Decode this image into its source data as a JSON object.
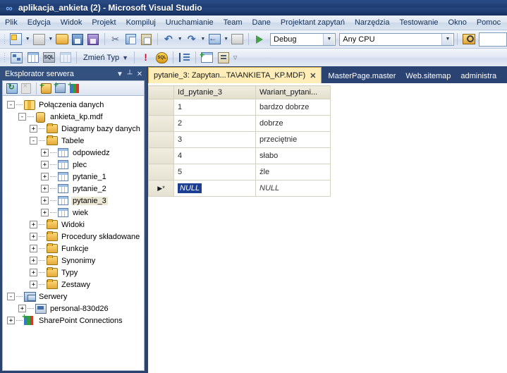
{
  "window": {
    "title": "aplikacja_ankieta (2) - Microsoft Visual Studio",
    "logo_icon": "visual-studio-infinity-icon"
  },
  "menu": {
    "items": [
      {
        "label": "Plik"
      },
      {
        "label": "Edycja"
      },
      {
        "label": "Widok"
      },
      {
        "label": "Projekt"
      },
      {
        "label": "Kompiluj"
      },
      {
        "label": "Uruchamianie"
      },
      {
        "label": "Team"
      },
      {
        "label": "Dane"
      },
      {
        "label": "Projektant zapytań"
      },
      {
        "label": "Narzędzia"
      },
      {
        "label": "Testowanie"
      },
      {
        "label": "Okno"
      },
      {
        "label": "Pomoc"
      }
    ]
  },
  "toolbar_standard": {
    "buttons": [
      {
        "icon": "new-project-icon"
      },
      {
        "icon": "new-web-site-icon"
      },
      {
        "icon": "open-file-icon"
      },
      {
        "icon": "save-icon"
      },
      {
        "icon": "save-all-icon"
      },
      {
        "icon": "cut-icon"
      },
      {
        "icon": "copy-icon"
      },
      {
        "icon": "paste-icon"
      },
      {
        "icon": "undo-icon"
      },
      {
        "icon": "redo-icon"
      },
      {
        "icon": "navigate-backward-icon"
      },
      {
        "icon": "navigate-forward-icon"
      },
      {
        "icon": "start-debugging-icon"
      }
    ],
    "configuration": {
      "value": "Debug",
      "dropdown_icon": "chevron-down-icon"
    },
    "platform": {
      "value": "Any CPU",
      "dropdown_icon": "chevron-down-icon"
    },
    "find_icon": "find-in-files-icon",
    "find_input": {
      "value": "",
      "placeholder": ""
    }
  },
  "toolbar_query": {
    "buttons": [
      {
        "icon": "show-diagram-pane-icon"
      },
      {
        "icon": "show-results-pane-icon"
      },
      {
        "icon": "show-sql-pane-icon"
      },
      {
        "icon": "show-grid-pane-icon"
      }
    ],
    "change_type": {
      "label": "Zmień Typ",
      "dropdown_icon": "chevron-down-icon"
    },
    "buttons2": [
      {
        "icon": "execute-sql-icon"
      },
      {
        "icon": "verify-sql-syntax-icon"
      },
      {
        "icon": "group-by-icon"
      },
      {
        "icon": "add-table-icon"
      },
      {
        "icon": "add-new-derived-table-icon"
      }
    ],
    "overflow_icon": "toolbar-overflow-icon"
  },
  "server_explorer": {
    "title": "Eksplorator serwera",
    "window_buttons": [
      {
        "icon": "chevron-down-icon"
      },
      {
        "icon": "pin-icon"
      },
      {
        "icon": "close-icon"
      }
    ],
    "toolbar": [
      {
        "icon": "refresh-icon"
      },
      {
        "icon": "disconnect-icon"
      },
      {
        "icon": "connect-to-database-icon"
      },
      {
        "icon": "connect-to-server-icon"
      },
      {
        "icon": "add-sharepoint-connection-icon"
      }
    ],
    "tree": [
      {
        "label": "Połączenia danych",
        "indent": 0,
        "expander": "-",
        "icon": "data-connections-icon",
        "selected": false
      },
      {
        "label": "ankieta_kp.mdf",
        "indent": 1,
        "expander": "-",
        "icon": "database-icon",
        "selected": false
      },
      {
        "label": "Diagramy bazy danych",
        "indent": 2,
        "expander": "+",
        "icon": "folder-icon",
        "selected": false
      },
      {
        "label": "Tabele",
        "indent": 2,
        "expander": "-",
        "icon": "folder-icon",
        "selected": false
      },
      {
        "label": "odpowiedz",
        "indent": 3,
        "expander": "+",
        "icon": "table-icon",
        "selected": false
      },
      {
        "label": "plec",
        "indent": 3,
        "expander": "+",
        "icon": "table-icon",
        "selected": false
      },
      {
        "label": "pytanie_1",
        "indent": 3,
        "expander": "+",
        "icon": "table-icon",
        "selected": false
      },
      {
        "label": "pytanie_2",
        "indent": 3,
        "expander": "+",
        "icon": "table-icon",
        "selected": false
      },
      {
        "label": "pytanie_3",
        "indent": 3,
        "expander": "+",
        "icon": "table-icon",
        "selected": true
      },
      {
        "label": "wiek",
        "indent": 3,
        "expander": "+",
        "icon": "table-icon",
        "selected": false
      },
      {
        "label": "Widoki",
        "indent": 2,
        "expander": "+",
        "icon": "folder-icon",
        "selected": false
      },
      {
        "label": "Procedury składowane",
        "indent": 2,
        "expander": "+",
        "icon": "folder-icon",
        "selected": false
      },
      {
        "label": "Funkcje",
        "indent": 2,
        "expander": "+",
        "icon": "folder-icon",
        "selected": false
      },
      {
        "label": "Synonimy",
        "indent": 2,
        "expander": "+",
        "icon": "folder-icon",
        "selected": false
      },
      {
        "label": "Typy",
        "indent": 2,
        "expander": "+",
        "icon": "folder-icon",
        "selected": false
      },
      {
        "label": "Zestawy",
        "indent": 2,
        "expander": "+",
        "icon": "folder-icon",
        "selected": false
      },
      {
        "label": "Serwery",
        "indent": 0,
        "expander": "-",
        "icon": "servers-icon",
        "selected": false
      },
      {
        "label": "personal-830d26",
        "indent": 1,
        "expander": "+",
        "icon": "computer-icon",
        "selected": false
      },
      {
        "label": "SharePoint Connections",
        "indent": 0,
        "expander": "+",
        "icon": "sharepoint-icon",
        "selected": false
      }
    ]
  },
  "document_tabs": [
    {
      "label": "pytanie_3: Zapytan...TA\\ANKIETA_KP.MDF)",
      "active": true,
      "close_icon": "close-icon"
    },
    {
      "label": "MasterPage.master",
      "active": false
    },
    {
      "label": "Web.sitemap",
      "active": false
    },
    {
      "label": "administra",
      "active": false
    }
  ],
  "results_grid": {
    "columns": [
      {
        "label": "Id_pytanie_3",
        "width": 110
      },
      {
        "label": "Wariant_pytani...",
        "width": 100
      }
    ],
    "rows": [
      {
        "marker": "",
        "cells": [
          "1",
          "bardzo dobrze"
        ],
        "is_new_row": false
      },
      {
        "marker": "",
        "cells": [
          "2",
          "dobrze"
        ],
        "is_new_row": false
      },
      {
        "marker": "",
        "cells": [
          "3",
          "przeciętnie"
        ],
        "is_new_row": false
      },
      {
        "marker": "",
        "cells": [
          "4",
          "słabo"
        ],
        "is_new_row": false
      },
      {
        "marker": "",
        "cells": [
          "5",
          "źle"
        ],
        "is_new_row": false
      },
      {
        "marker": "▶*",
        "cells": [
          "NULL",
          "NULL"
        ],
        "is_new_row": true
      }
    ]
  },
  "colors": {
    "titlebar": "#24457e",
    "workspace": "#2b4372",
    "active_tab": "#ffedb8",
    "selection": "#1c3f94",
    "tree_selection": "#ede8d6"
  }
}
